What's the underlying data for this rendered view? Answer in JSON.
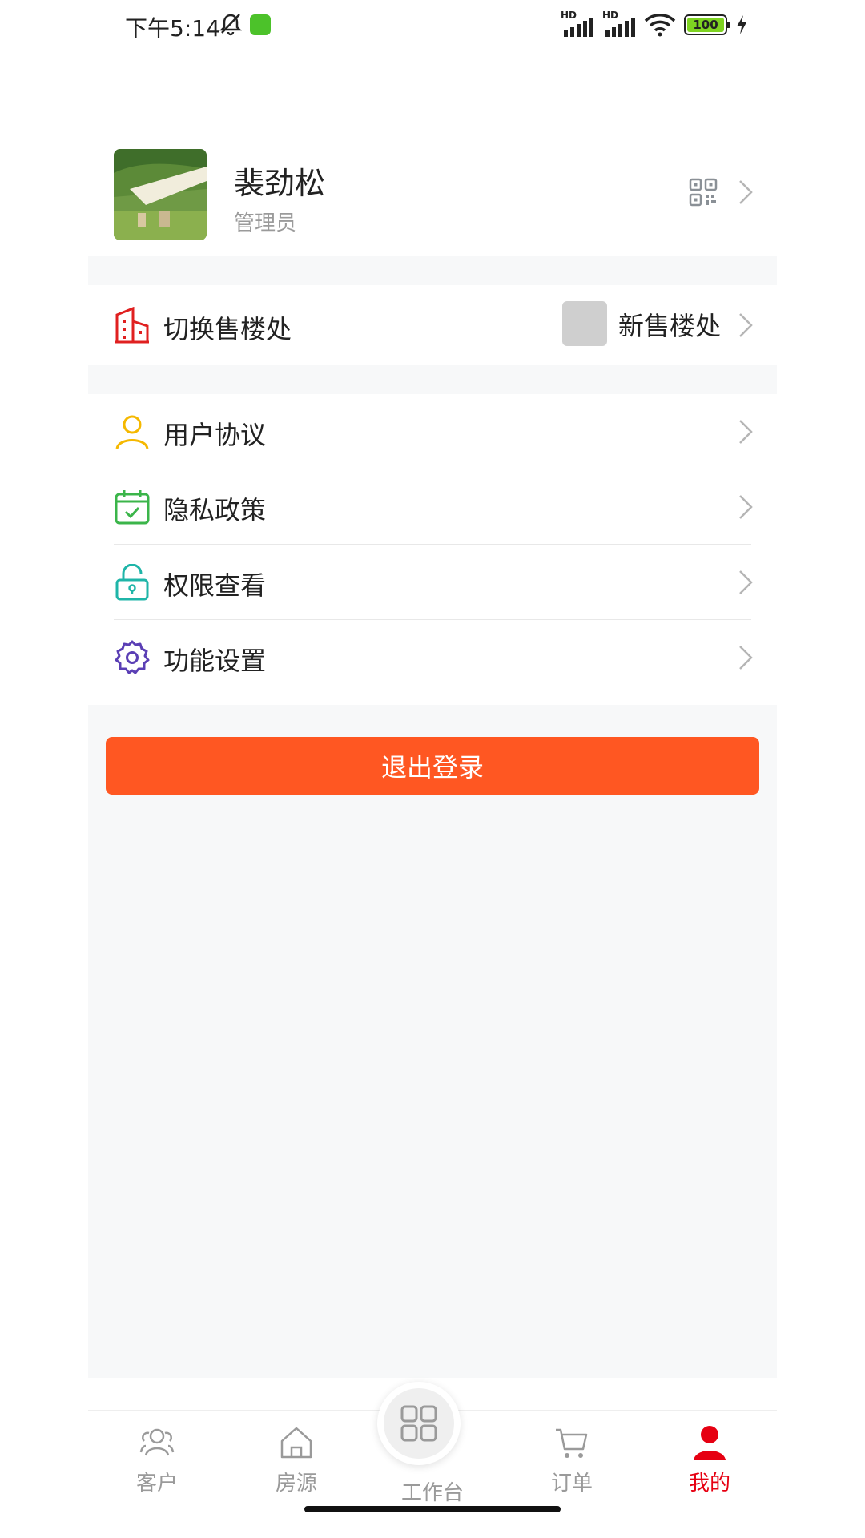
{
  "status_bar": {
    "time": "下午5:14",
    "signal_1_label": "HD",
    "signal_2_label": "HD",
    "battery": "100",
    "icons": [
      "bell-muted-icon",
      "app-notification-icon",
      "signal-icon",
      "signal-icon",
      "wifi-icon",
      "battery-icon",
      "charging-icon"
    ]
  },
  "profile": {
    "name": "裴劲松",
    "role": "管理员",
    "qr_icon": "qr-code-icon"
  },
  "office": {
    "label": "切换售楼处",
    "current": "新售楼处",
    "icon": "building-icon"
  },
  "menu": {
    "items": [
      {
        "label": "用户协议",
        "icon": "user-icon",
        "color": "#f5b800"
      },
      {
        "label": "隐私政策",
        "icon": "calendar-check-icon",
        "color": "#3bb54a"
      },
      {
        "label": "权限查看",
        "icon": "lock-icon",
        "color": "#1fb5a8"
      },
      {
        "label": "功能设置",
        "icon": "gear-icon",
        "color": "#5b3fb5"
      }
    ]
  },
  "logout": {
    "label": "退出登录",
    "color": "#ff5722"
  },
  "tabbar": {
    "items": [
      {
        "label": "客户",
        "icon": "customers-icon"
      },
      {
        "label": "房源",
        "icon": "house-icon"
      },
      {
        "label": "工作台",
        "icon": "grid-icon"
      },
      {
        "label": "订单",
        "icon": "cart-icon"
      },
      {
        "label": "我的",
        "icon": "person-icon",
        "active": true
      }
    ],
    "active_color": "#e60012"
  }
}
